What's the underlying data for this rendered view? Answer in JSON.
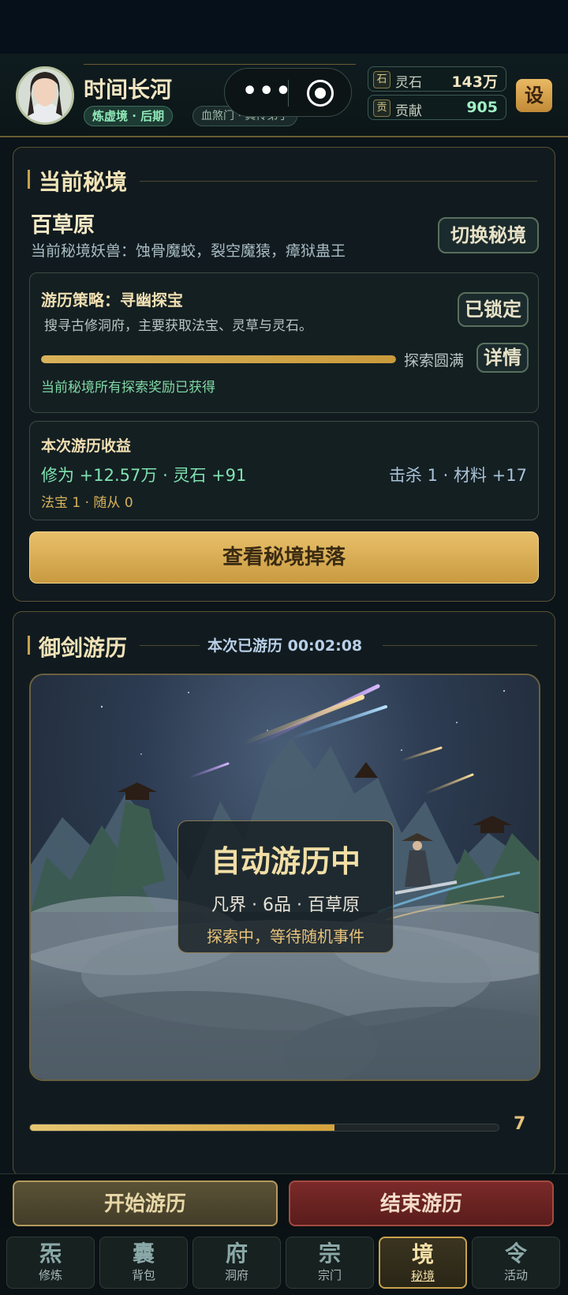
{
  "header": {
    "player_name": "时间长河",
    "realm_badge": "炼虚境 · 后期",
    "sect_badge": "血煞门 · 真传弟子",
    "resources": [
      {
        "icon": "石",
        "label": "灵石",
        "value": "143万",
        "color": "#f2e6c2"
      },
      {
        "icon": "贡",
        "label": "贡献",
        "value": "905",
        "color": "#9ff0c4"
      }
    ],
    "settings_label": "设",
    "capsule_more_icon": "more-dots-icon",
    "capsule_close_icon": "target-icon"
  },
  "current_realm": {
    "section_title": "当前秘境",
    "realm_name": "百草原",
    "monsters_text": "当前秘境妖兽：蚀骨魔蛟，裂空魔猿，瘴狱蛊王",
    "switch_button": "切换秘境",
    "strategy": {
      "title": "游历策略：寻幽探宝",
      "description": "搜寻古修洞府，主要获取法宝、灵草与灵石。",
      "locked_label": "已锁定",
      "progress_fraction": 1.0,
      "progress_status": "探索圆满",
      "details_button": "详情",
      "reward_note": "当前秘境所有探索奖励已获得"
    },
    "earnings": {
      "title": "本次游历收益",
      "left_line": "修为 +12.57万 · 灵石 +91",
      "right_line": "击杀 1 · 材料 +17",
      "bottom_line": "法宝 1 · 随从 0"
    },
    "view_drops_button": "查看秘境掉落"
  },
  "sword_travel": {
    "section_title": "御剑游历",
    "timer_text": "本次已游历 00:02:08",
    "overlay_title": "自动游历中",
    "overlay_subtitle": "凡界 · 6品 · 百草原",
    "overlay_status": "探索中，等待随机事件",
    "progress_fraction": 0.65,
    "count": "7"
  },
  "actions": {
    "start": "开始游历",
    "end": "结束游历"
  },
  "nav": [
    {
      "glyph": "炁",
      "label": "修炼",
      "active": false
    },
    {
      "glyph": "囊",
      "label": "背包",
      "active": false
    },
    {
      "glyph": "府",
      "label": "洞府",
      "active": false
    },
    {
      "glyph": "宗",
      "label": "宗门",
      "active": false
    },
    {
      "glyph": "境",
      "label": "秘境",
      "active": true
    },
    {
      "glyph": "令",
      "label": "活动",
      "active": false
    }
  ]
}
